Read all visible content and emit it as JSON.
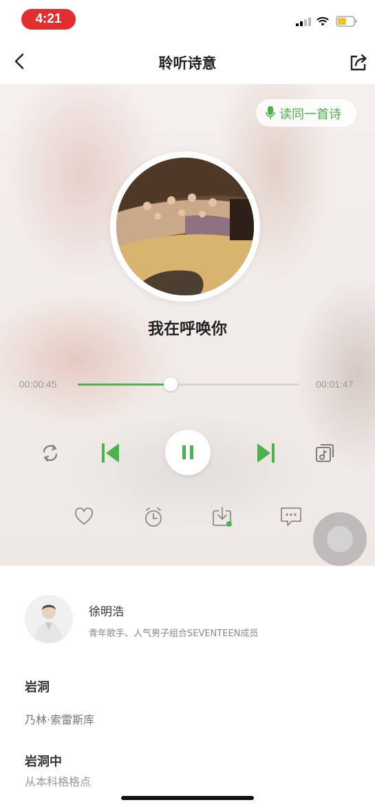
{
  "status_bar": {
    "time": "4:21"
  },
  "nav": {
    "title": "聆听诗意"
  },
  "player": {
    "read_same_poem_label": "读同一首诗",
    "song_title": "我在呼唤你",
    "current_time": "00:00:45",
    "total_time": "00:01:47",
    "progress": 0.42
  },
  "reader": {
    "name": "徐明浩",
    "description": "青年歌手、人气男子组合SEVENTEEN成员"
  },
  "poem": {
    "title": "岩洞",
    "author": "乃林·索雷斯库",
    "section_title": "岩洞中",
    "first_line": "从本科格格点 "
  },
  "colors": {
    "accent": "#4bb34b",
    "status_pill": "#e22e2e"
  },
  "icons": [
    "back-icon",
    "share-icon",
    "mic-icon",
    "loop-icon",
    "previous-icon",
    "pause-icon",
    "next-icon",
    "playlist-icon",
    "heart-icon",
    "timer-icon",
    "download-icon",
    "comment-icon"
  ]
}
